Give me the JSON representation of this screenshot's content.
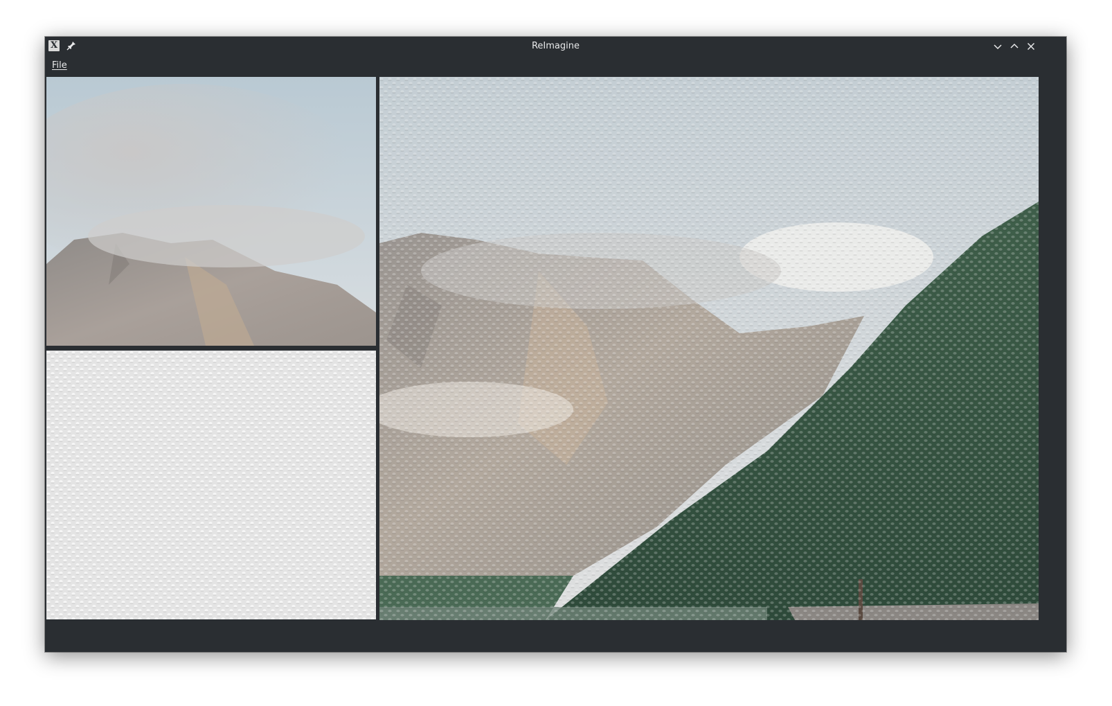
{
  "window": {
    "title": "ReImagine",
    "app_icon": "x-app-icon",
    "buttons": [
      "minimize-icon",
      "maximize-icon",
      "close-icon"
    ]
  },
  "menubar": {
    "items": [
      {
        "label": "File"
      }
    ]
  },
  "panes": {
    "content_image": "mountain-photo",
    "style_image": "canvas-texture",
    "output_image": "stylized-mountain-lake"
  },
  "colors": {
    "window_bg": "#2a2e32",
    "text": "#e8e9ea"
  }
}
